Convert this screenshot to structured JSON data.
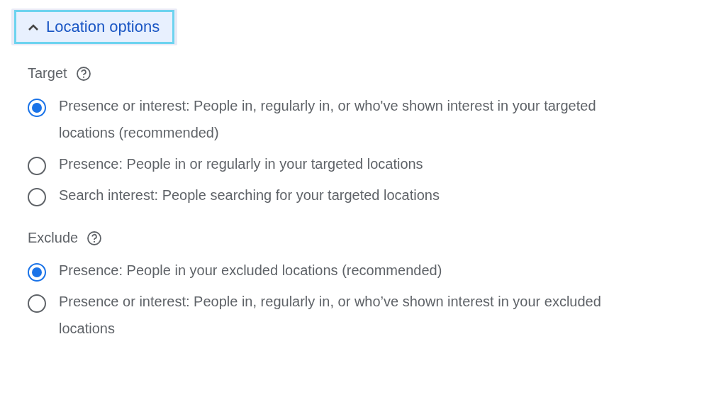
{
  "toggle": {
    "label": "Location options",
    "expanded": true
  },
  "sections": [
    {
      "title": "Target",
      "options": [
        {
          "label": "Presence or interest: People in, regularly in, or who've shown interest in your targeted locations (recommended)",
          "selected": true
        },
        {
          "label": "Presence: People in or regularly in your targeted locations",
          "selected": false
        },
        {
          "label": "Search interest: People searching for your targeted locations",
          "selected": false
        }
      ]
    },
    {
      "title": "Exclude",
      "options": [
        {
          "label": "Presence: People in your excluded locations (recommended)",
          "selected": true
        },
        {
          "label": "Presence or interest: People in, regularly in, or who’ve shown interest in your excluded locations",
          "selected": false
        }
      ]
    }
  ]
}
